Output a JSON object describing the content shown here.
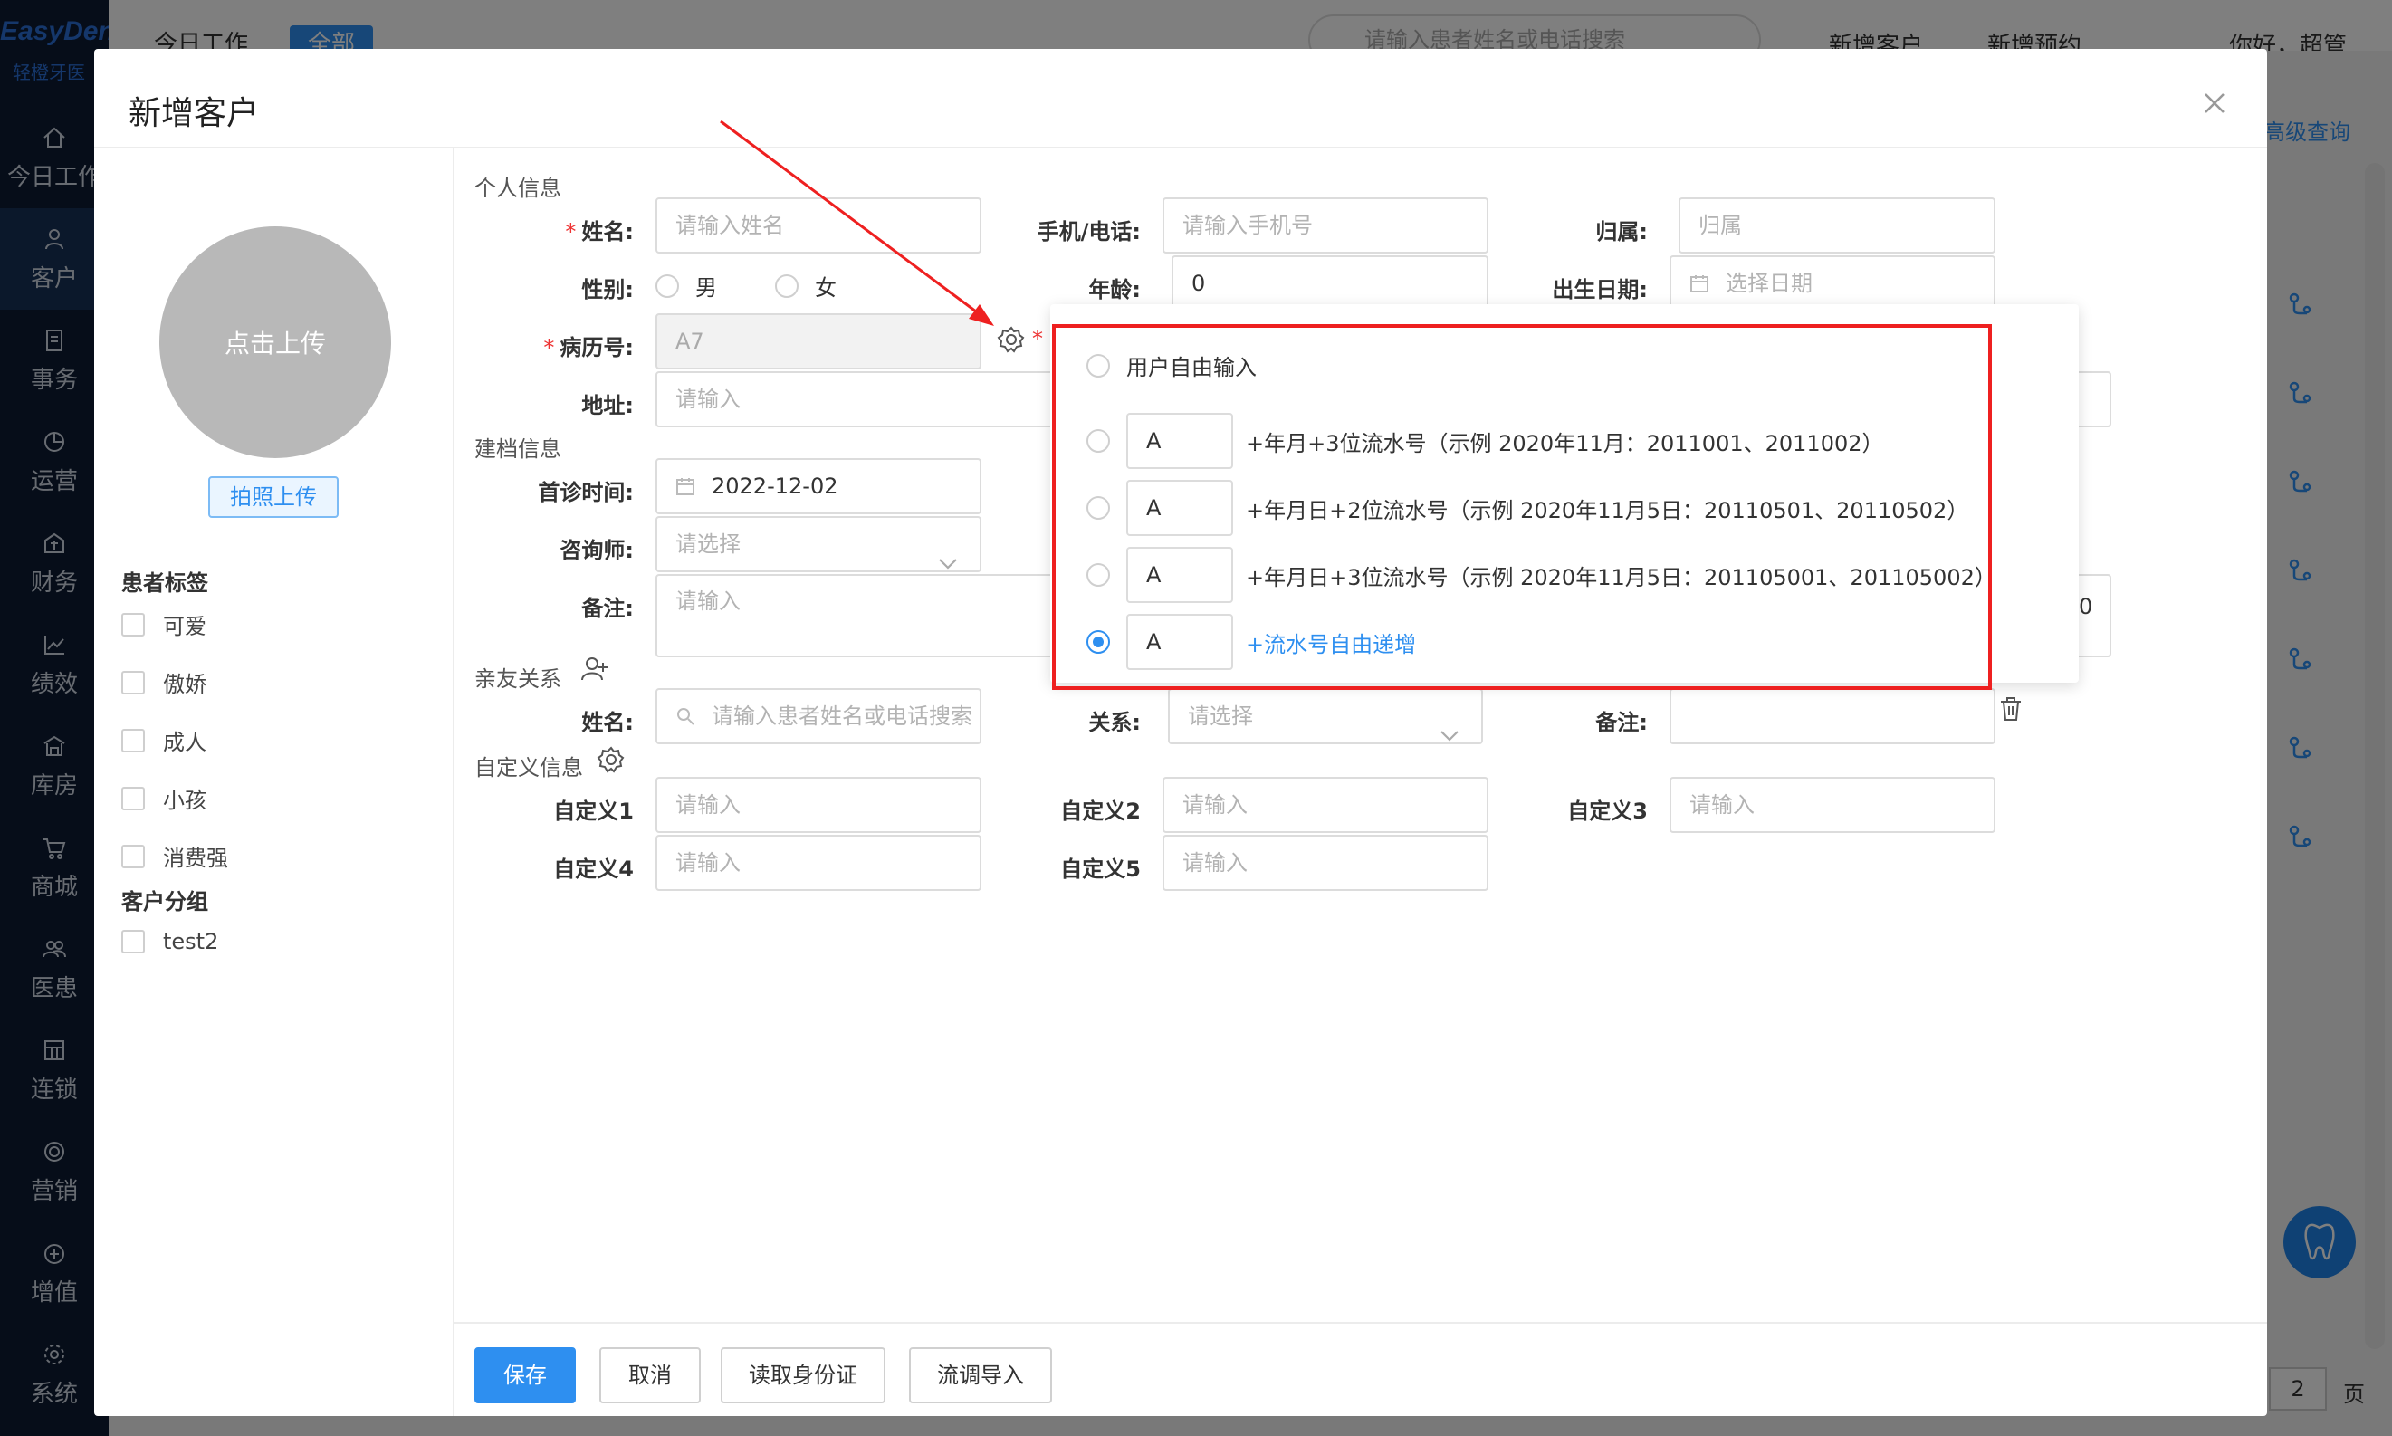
{
  "app": {
    "logo": "EasyDent",
    "logo_sub": "轻橙牙医",
    "nav": [
      {
        "label": "今日工作",
        "icon": "home-icon"
      },
      {
        "label": "客户",
        "icon": "user-icon"
      },
      {
        "label": "事务",
        "icon": "document-icon"
      },
      {
        "label": "运营",
        "icon": "pie-icon"
      },
      {
        "label": "财务",
        "icon": "wallet-icon"
      },
      {
        "label": "绩效",
        "icon": "chart-icon"
      },
      {
        "label": "库房",
        "icon": "warehouse-icon"
      },
      {
        "label": "商城",
        "icon": "cart-icon"
      },
      {
        "label": "医患",
        "icon": "people-icon"
      },
      {
        "label": "连锁",
        "icon": "store-icon"
      },
      {
        "label": "营销",
        "icon": "target-icon"
      },
      {
        "label": "增值",
        "icon": "gift-icon"
      },
      {
        "label": "系统",
        "icon": "gear-icon"
      }
    ],
    "tabs": [
      "今日工作",
      "全部"
    ],
    "search_placeholder": "请输入患者姓名或电话搜索",
    "top_links": [
      "新增客户",
      "新增预约",
      "你好，超管"
    ],
    "advanced_query": "高级查询",
    "pager_page": "2",
    "pager_suffix": "页"
  },
  "modal": {
    "title": "新增客户",
    "avatar_label": "点击上传",
    "photo_button": "拍照上传",
    "tags_heading": "患者标签",
    "tags": [
      "可爱",
      "傲娇",
      "成人",
      "小孩",
      "消费强"
    ],
    "groups_heading": "客户分组",
    "groups": [
      "test2"
    ],
    "personal": {
      "section": "个人信息",
      "name_label": "姓名:",
      "name_placeholder": "请输入姓名",
      "phone_label": "手机/电话:",
      "phone_placeholder": "请输入手机号",
      "belong_label": "归属:",
      "belong_placeholder": "归属",
      "gender_label": "性别:",
      "gender_male": "男",
      "gender_female": "女",
      "age_label": "年龄:",
      "age_value": "0",
      "birth_label": "出生日期:",
      "birth_placeholder": "选择日期",
      "record_label": "病历号:",
      "record_value": "A7",
      "address_label": "地址:",
      "address_placeholder": "请输入",
      "right_partial_value": "0"
    },
    "archive": {
      "section": "建档信息",
      "first_visit_label": "首诊时间:",
      "first_visit_value": "2022-12-02",
      "consultant_label": "咨询师:",
      "consultant_placeholder": "请选择",
      "remark_label": "备注:",
      "remark_placeholder": "请输入"
    },
    "relatives": {
      "section": "亲友关系",
      "name_label": "姓名:",
      "name_placeholder": "请输入患者姓名或电话搜索",
      "relation_label": "关系:",
      "relation_placeholder": "请选择",
      "remark_label": "备注:"
    },
    "custom": {
      "section": "自定义信息",
      "fields": [
        {
          "label": "自定义1",
          "placeholder": "请输入"
        },
        {
          "label": "自定义2",
          "placeholder": "请输入"
        },
        {
          "label": "自定义3",
          "placeholder": "请输入"
        },
        {
          "label": "自定义4",
          "placeholder": "请输入"
        },
        {
          "label": "自定义5",
          "placeholder": "请输入"
        }
      ]
    },
    "buttons": {
      "save": "保存",
      "cancel": "取消",
      "read_id": "读取身份证",
      "import": "流调导入"
    }
  },
  "popover": {
    "option_free": "用户自由输入",
    "options": [
      {
        "prefix": "A",
        "text": "+年月+3位流水号（示例 2020年11月：2011001、2011002）",
        "selected": false
      },
      {
        "prefix": "A",
        "text": "+年月日+2位流水号（示例 2020年11月5日：20110501、20110502）",
        "selected": false
      },
      {
        "prefix": "A",
        "text": "+年月日+3位流水号（示例 2020年11月5日：201105001、201105002）",
        "selected": false
      },
      {
        "prefix": "A",
        "text": "+流水号自由递增",
        "selected": true
      }
    ]
  },
  "colors": {
    "primary": "#2e8ff0",
    "sidebar": "#0c1b33",
    "highlight_border": "#ee2020",
    "required": "#e33333"
  }
}
